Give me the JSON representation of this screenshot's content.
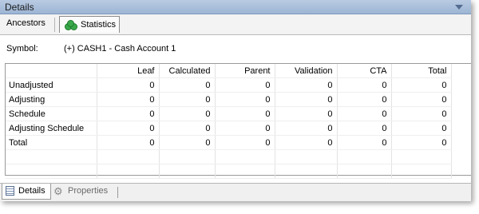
{
  "panel": {
    "title": "Details"
  },
  "tabs": [
    {
      "label": "Ancestors",
      "active": false
    },
    {
      "label": "Statistics",
      "active": true,
      "icon": "statistics-icon"
    }
  ],
  "symbol": {
    "label": "Symbol:",
    "value": "(+) CASH1 - Cash Account 1"
  },
  "table": {
    "columns": [
      "",
      "Leaf",
      "Calculated",
      "Parent",
      "Validation",
      "CTA",
      "Total"
    ],
    "rows": [
      {
        "label": "Unadjusted",
        "values": [
          "0",
          "0",
          "0",
          "0",
          "0",
          "0"
        ]
      },
      {
        "label": "Adjusting",
        "values": [
          "0",
          "0",
          "0",
          "0",
          "0",
          "0"
        ]
      },
      {
        "label": "Schedule",
        "values": [
          "0",
          "0",
          "0",
          "0",
          "0",
          "0"
        ]
      },
      {
        "label": "Adjusting Schedule",
        "values": [
          "0",
          "0",
          "0",
          "0",
          "0",
          "0"
        ]
      },
      {
        "label": "Total",
        "values": [
          "0",
          "0",
          "0",
          "0",
          "0",
          "0"
        ]
      }
    ]
  },
  "bottom_tabs": [
    {
      "label": "Details",
      "active": true,
      "icon": "details-icon"
    },
    {
      "label": "Properties",
      "active": false,
      "icon": "gear-icon"
    }
  ],
  "colors": {
    "titlebar": "#9db5d4",
    "accent": "#3aa84a"
  }
}
